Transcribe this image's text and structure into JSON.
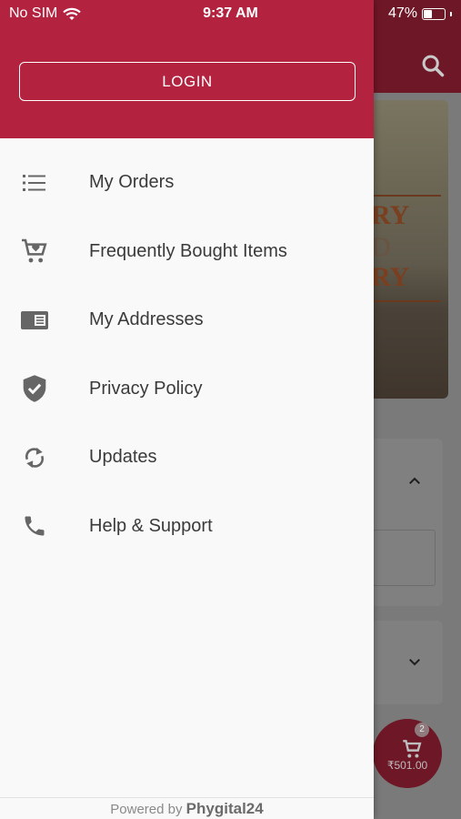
{
  "status_bar": {
    "carrier": "No SIM",
    "time": "9:37 AM",
    "battery_text": "47%",
    "battery_level": 0.47
  },
  "drawer": {
    "login_label": "LOGIN",
    "menu": [
      {
        "label": "My Orders",
        "icon": "list-icon"
      },
      {
        "label": "Frequently Bought Items",
        "icon": "cart-heart-icon"
      },
      {
        "label": "My Addresses",
        "icon": "address-card-icon"
      },
      {
        "label": "Privacy Policy",
        "icon": "shield-check-icon"
      },
      {
        "label": "Updates",
        "icon": "sync-icon"
      },
      {
        "label": "Help & Support",
        "icon": "phone-icon"
      }
    ],
    "footer": {
      "prefix": "Powered by",
      "brand": "Phygital24"
    }
  },
  "background": {
    "banner_words": [
      "RY",
      "D",
      "RY"
    ],
    "cart": {
      "badge": "2",
      "amount": "₹501.00"
    }
  },
  "colors": {
    "brand": "#b3223f",
    "drawer_bg": "#f9f9f9",
    "text": "#3a3a3a",
    "icon": "#666666"
  }
}
